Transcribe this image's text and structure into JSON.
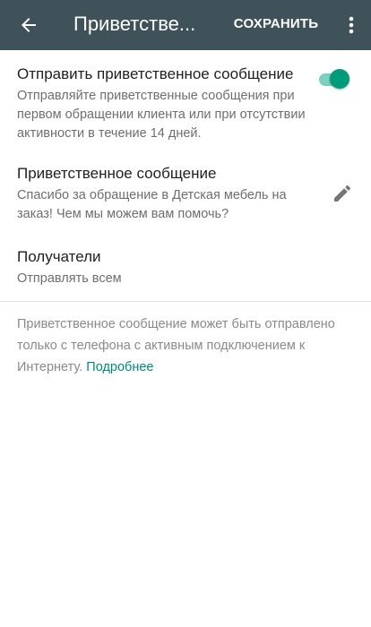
{
  "appbar": {
    "title": "Приветстве...",
    "save_label": "СОХРАНИТЬ",
    "background": "#3f5159"
  },
  "toggle_row": {
    "title": "Отправить приветственное сообщение",
    "description": "Отправляйте приветственные сообщения при первом обращении клиента или при отсутствии активности в течение 14 дней.",
    "enabled": true,
    "accent": "#009b7a"
  },
  "message_row": {
    "title": "Приветственное сообщение",
    "text": "Спасибо за обращение в Детская мебель на заказ! Чем мы можем вам помочь?"
  },
  "recipients_row": {
    "title": "Получатели",
    "value": "Отправлять всем"
  },
  "note": {
    "text": "Приветственное сообщение может быть отправлено только с телефона с активным подключением к Интернету. ",
    "link": "Подробнее",
    "link_color": "#00897b"
  },
  "icons": {
    "back": "arrow-left-icon",
    "more": "more-vertical-icon",
    "edit": "pencil-icon"
  }
}
